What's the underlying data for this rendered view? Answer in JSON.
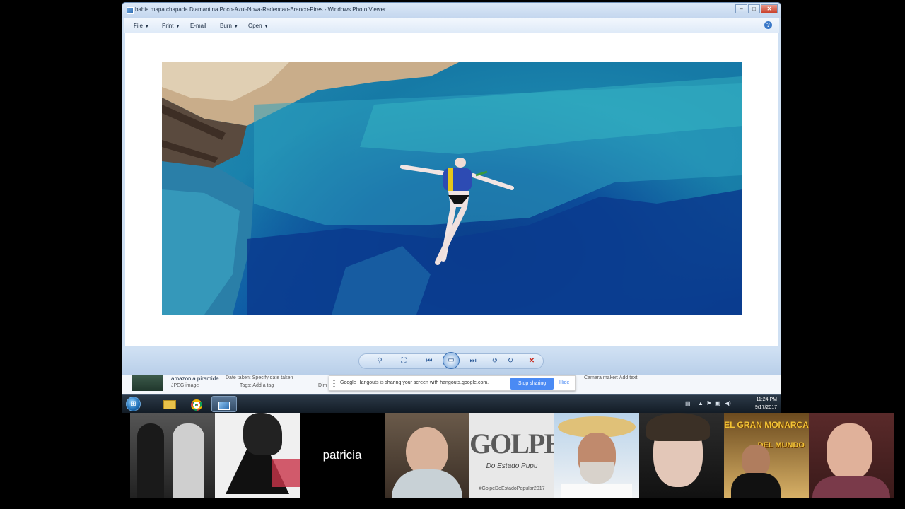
{
  "window": {
    "title": "bahia mapa chapada Diamantina Poco-Azul-Nova-Redencao-Branco-Pires - Windows Photo Viewer",
    "minimize": "–",
    "maximize": "□",
    "close": "✕"
  },
  "menu": {
    "file": "File",
    "print": "Print",
    "email": "E-mail",
    "burn": "Burn",
    "open": "Open",
    "help": "?"
  },
  "controls": {
    "zoom_icon": "magnifier-icon",
    "actual_size_icon": "actual-size-icon",
    "prev_icon": "previous-icon",
    "slideshow_icon": "slideshow-icon",
    "next_icon": "next-icon",
    "rotate_ccw_icon": "rotate-counterclockwise-icon",
    "rotate_cw_icon": "rotate-clockwise-icon",
    "delete_icon": "delete-icon"
  },
  "explorer": {
    "file_name": "amazonia piramide",
    "file_type": "JPEG image",
    "date_taken_label": "Date taken:",
    "date_taken_value": "Specify date taken",
    "tags_label": "Tags:",
    "tags_value": "Add a tag",
    "dimensions_label": "Dim",
    "camera_label": "Camera maker:",
    "camera_value": "Add text"
  },
  "hangouts": {
    "message": "Google Hangouts is sharing your screen with hangouts.google.com.",
    "stop_button": "Stop sharing",
    "hide_button": "Hide"
  },
  "taskbar": {
    "start_icon": "windows-start-icon",
    "apps": [
      "file-explorer-icon",
      "chrome-icon",
      "photo-viewer-icon"
    ],
    "time": "11:24 PM",
    "date": "9/17/2017"
  },
  "participants": {
    "name_tile": "patricia",
    "golpe_title": "GOLPE",
    "golpe_subtitle": "Do Estado Pupu",
    "golpe_hashtag": "#GolpeDoEstadoPopular2017",
    "banner_line1": "EL GRAN MONARCA",
    "banner_line2": "DEL MUNDO"
  },
  "colors": {
    "window_chrome": "#cfe0f3",
    "stop_sharing_blue": "#4a8af4",
    "delete_red": "#c8261a"
  }
}
